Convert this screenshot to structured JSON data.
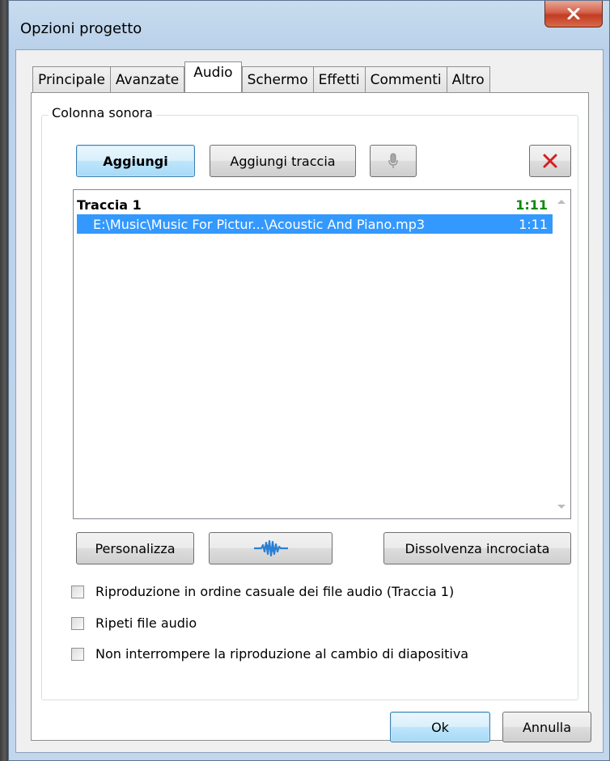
{
  "window": {
    "title": "Opzioni progetto",
    "close_label": "close"
  },
  "tabs": [
    {
      "label": "Principale"
    },
    {
      "label": "Avanzate"
    },
    {
      "label": "Audio",
      "active": true
    },
    {
      "label": "Schermo"
    },
    {
      "label": "Effetti"
    },
    {
      "label": "Commenti"
    },
    {
      "label": "Altro"
    }
  ],
  "soundtrack": {
    "group_title": "Colonna sonora",
    "add_label": "Aggiungi",
    "add_track_label": "Aggiungi traccia",
    "record_icon": "microphone-icon",
    "delete_icon": "delete-x-icon",
    "tracks": [
      {
        "name": "Traccia 1",
        "duration": "1:11",
        "files": [
          {
            "path": "E:\\Music\\Music For Pictur...\\Acoustic And Piano.mp3",
            "duration": "1:11",
            "selected": true
          }
        ]
      }
    ],
    "customize_label": "Personalizza",
    "waveform_icon": "waveform-icon",
    "crossfade_label": "Dissolvenza incrociata"
  },
  "options": [
    {
      "label": "Riproduzione in ordine casuale dei file audio (Traccia 1)",
      "checked": false
    },
    {
      "label": "Ripeti file audio",
      "checked": false
    },
    {
      "label": "Non interrompere la riproduzione al cambio di diapositiva",
      "checked": false
    }
  ],
  "footer": {
    "ok_label": "Ok",
    "cancel_label": "Annulla"
  },
  "colors": {
    "selection": "#3399ff",
    "duration_green": "#0a8a0a",
    "delete_red": "#d42020",
    "waveform_blue": "#2a7fd4"
  }
}
